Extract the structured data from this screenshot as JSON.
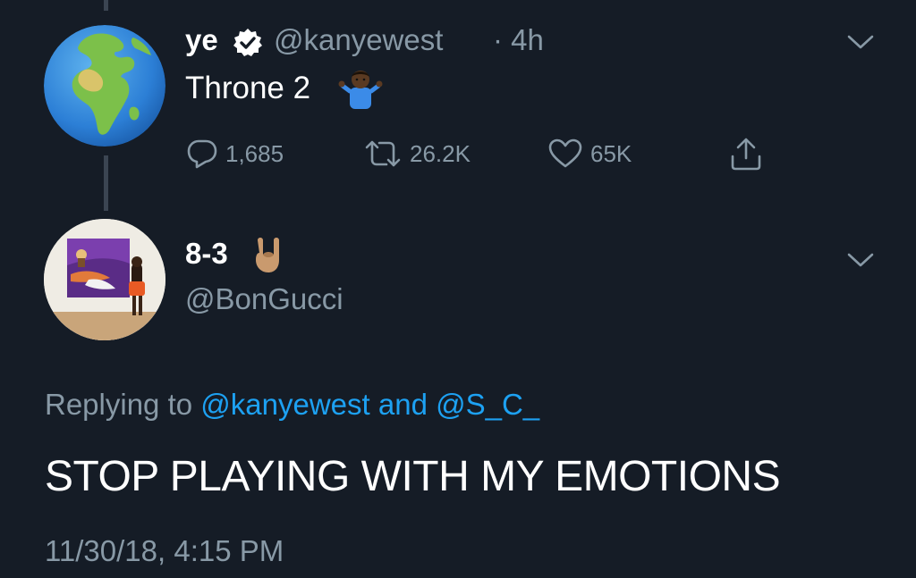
{
  "thread": {
    "tweet": {
      "display_name": "ye",
      "handle": "@kanyewest",
      "time": "· 4h",
      "text": "Throne 2",
      "actions": {
        "replies": "1,685",
        "retweets": "26.2K",
        "likes": "65K"
      }
    },
    "reply": {
      "display_name": "8-3",
      "handle": "@BonGucci",
      "replying_prefix": "Replying to",
      "replying_user1": "@kanyewest",
      "replying_and": "and",
      "replying_user2": "@S_C_",
      "text": "STOP PLAYING WITH MY EMOTIONS",
      "timestamp": "11/30/18, 4:15 PM"
    }
  },
  "colors": {
    "background": "#151c26",
    "secondary_text": "#8899a6",
    "link": "#1da1f2"
  },
  "icons": [
    "globe-avatar",
    "verified-badge-icon",
    "shrug-emoji-icon",
    "chevron-down-icon",
    "reply-icon",
    "retweet-icon",
    "like-icon",
    "share-icon",
    "horns-emoji-icon"
  ]
}
